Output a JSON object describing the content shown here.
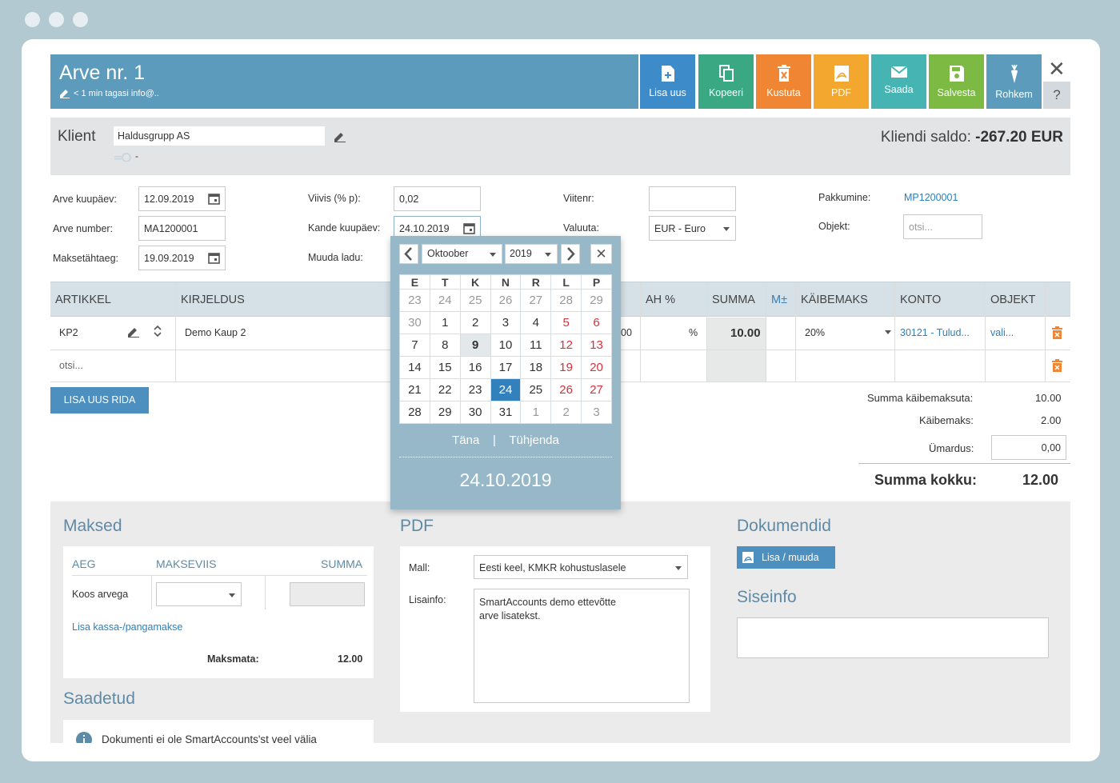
{
  "header": {
    "title": "Arve nr. 1",
    "subtitle": "< 1 min tagasi info@..",
    "buttons": [
      {
        "label": "Lisa uus",
        "color": "#3d8cc9"
      },
      {
        "label": "Kopeeri",
        "color": "#3aa883"
      },
      {
        "label": "Kustuta",
        "color": "#f08634"
      },
      {
        "label": "PDF",
        "color": "#f3a72f"
      },
      {
        "label": "Saada",
        "color": "#45b4b2"
      },
      {
        "label": "Salvesta",
        "color": "#7cba44"
      },
      {
        "label": "Rohkem",
        "color": "#5d9bbd"
      }
    ],
    "help": "?"
  },
  "client": {
    "label": "Klient",
    "value": "Haldusgrupp AS",
    "sub": "-",
    "saldo_label": "Kliendi saldo:",
    "saldo_value": "-267.20 EUR"
  },
  "form": {
    "arve_kuupaev_label": "Arve kuupäev:",
    "arve_kuupaev": "12.09.2019",
    "arve_number_label": "Arve number:",
    "arve_number": "MA1200001",
    "maksetahtaeg_label": "Maksetähtaeg:",
    "maksetahtaeg": "19.09.2019",
    "viivis_label": "Viivis (% p):",
    "viivis": "0,02",
    "kande_label": "Kande kuupäev:",
    "kande": "24.10.2019",
    "muuda_ladu_label": "Muuda ladu:",
    "viitenr_label": "Viitenr:",
    "viitenr": "",
    "valuuta_label": "Valuuta:",
    "valuuta": "EUR - Euro",
    "pakkumine_label": "Pakkumine:",
    "pakkumine": "MP1200001",
    "objekt_label": "Objekt:",
    "objekt_placeholder": "otsi..."
  },
  "table": {
    "headers": [
      "ARTIKKEL",
      "KIRJELDUS",
      "AH %",
      "SUMMA",
      "M±",
      "KÄIBEMAKS",
      "KONTO",
      "OBJEKT"
    ],
    "row1": {
      "artikkel": "KP2",
      "kirjeldus": "Demo Kaup 2",
      "partial": "00",
      "pct": "%",
      "summa": "10.00",
      "kaibemaks": "20%",
      "konto": "30121 - Tulud...",
      "objekt": "vali..."
    },
    "row2": {
      "artikkel": "otsi..."
    },
    "add_row": "LISA UUS RIDA"
  },
  "totals": {
    "summa_kaibemaksuta_label": "Summa käibemaksuta:",
    "summa_kaibemaksuta": "10.00",
    "kaibemaks_label": "Käibemaks:",
    "kaibemaks": "2.00",
    "umardus_label": "Ümardus:",
    "umardus": "0,00",
    "kokku_label": "Summa kokku:",
    "kokku": "12.00"
  },
  "maksed": {
    "title": "Maksed",
    "col_aeg": "AEG",
    "col_makseviis": "MAKSEVIIS",
    "col_summa": "SUMMA",
    "row_label": "Koos arvega",
    "add_link": "Lisa kassa-/pangamakse",
    "maksmata_label": "Maksmata:",
    "maksmata": "12.00"
  },
  "saadetud": {
    "title": "Saadetud",
    "notice": "Dokumenti ei ole SmartAccounts'st veel välja"
  },
  "pdf": {
    "title": "PDF",
    "mall_label": "Mall:",
    "mall": "Eesti keel, KMKR kohustuslasele",
    "lisainfo_label": "Lisainfo:",
    "lisainfo": "SmartAccounts demo ettevõtte\narve lisatekst."
  },
  "dokumendid": {
    "title": "Dokumendid",
    "button": "Lisa / muuda",
    "siseinfo_title": "Siseinfo"
  },
  "calendar": {
    "month": "Oktoober",
    "year": "2019",
    "weekdays": [
      "E",
      "T",
      "K",
      "N",
      "R",
      "L",
      "P"
    ],
    "weeks": [
      [
        "23",
        "24",
        "25",
        "26",
        "27",
        "28",
        "29"
      ],
      [
        "30",
        "1",
        "2",
        "3",
        "4",
        "5",
        "6"
      ],
      [
        "7",
        "8",
        "9",
        "10",
        "11",
        "12",
        "13"
      ],
      [
        "14",
        "15",
        "16",
        "17",
        "18",
        "19",
        "20"
      ],
      [
        "21",
        "22",
        "23",
        "24",
        "25",
        "26",
        "27"
      ],
      [
        "28",
        "29",
        "30",
        "31",
        "1",
        "2",
        "3"
      ]
    ],
    "today_btn": "Täna",
    "divider": "|",
    "clear_btn": "Tühjenda",
    "selected": "24.10.2019"
  }
}
